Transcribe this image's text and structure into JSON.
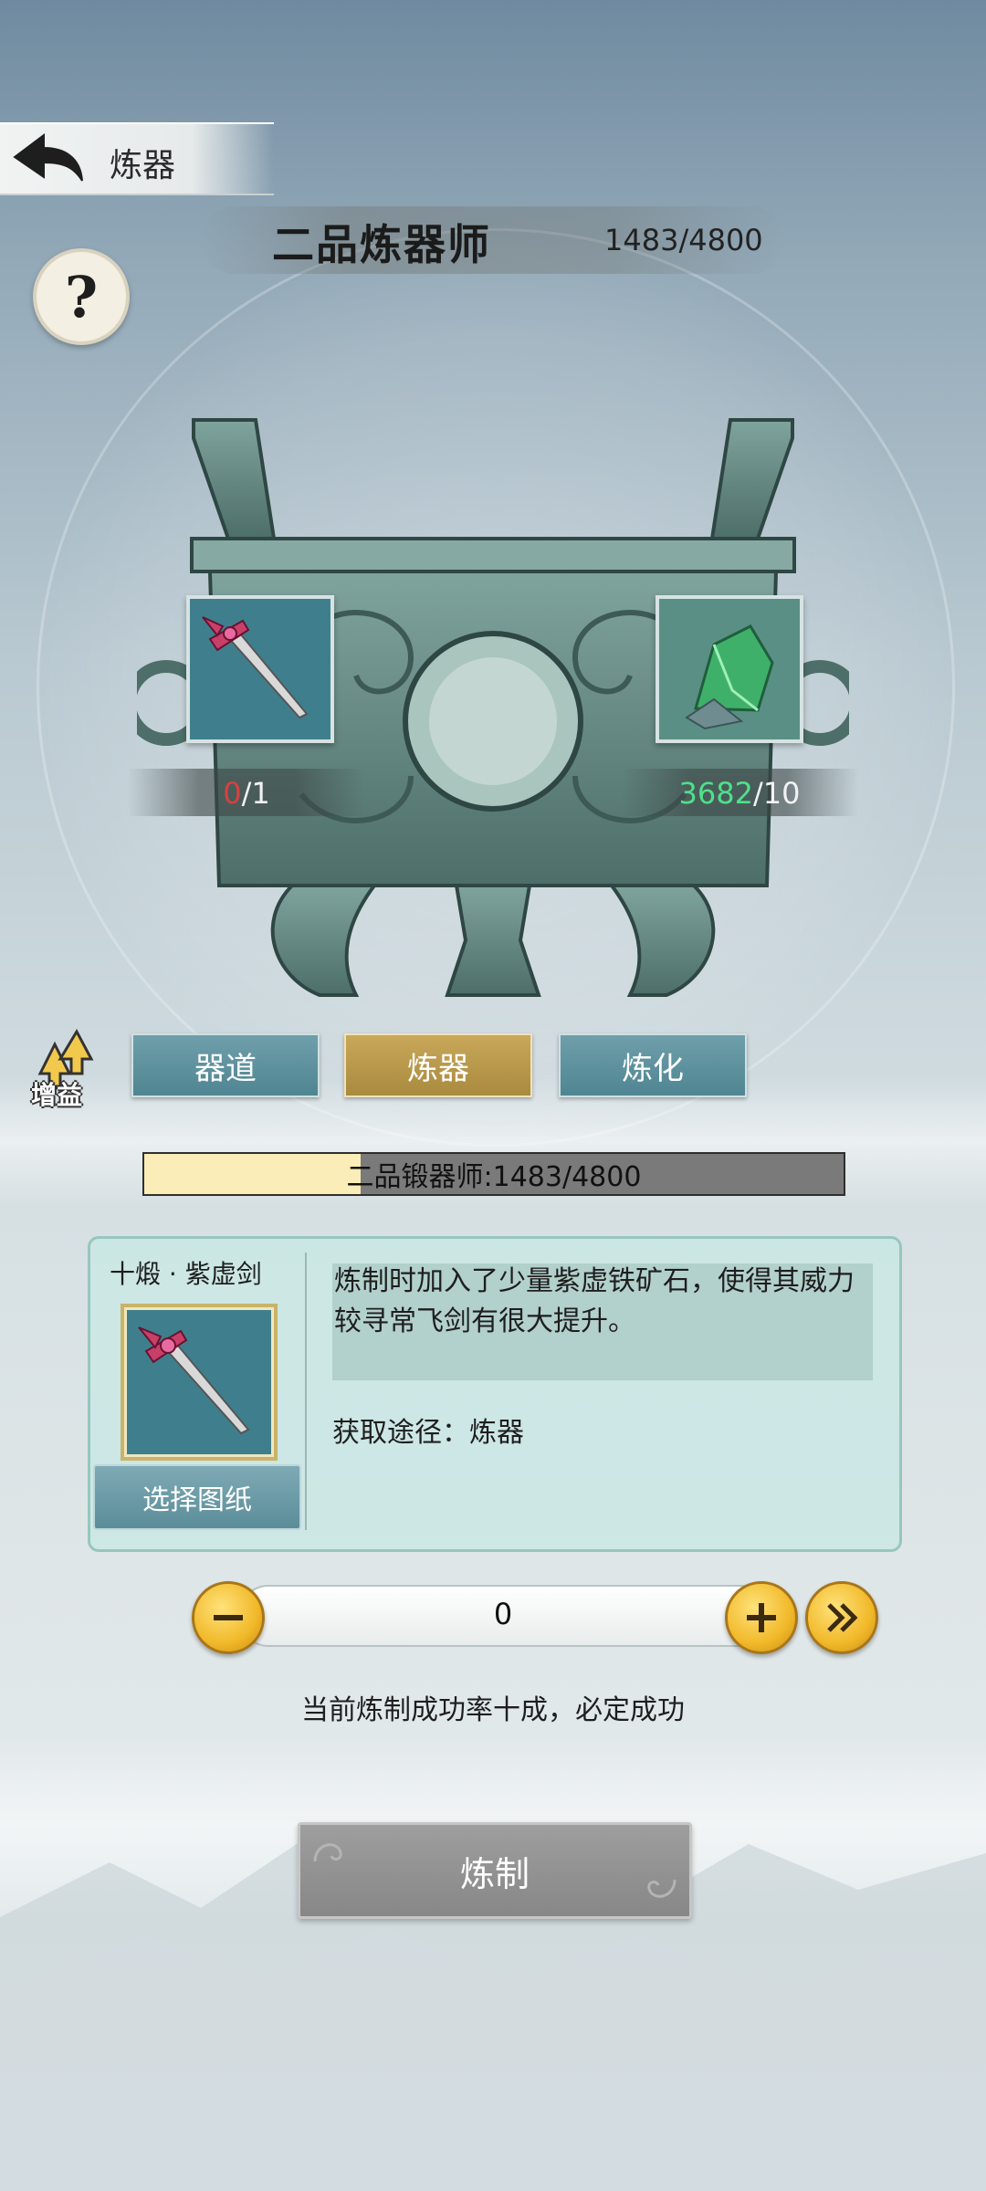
{
  "header": {
    "title": "炼器"
  },
  "rank": {
    "title": "二品炼器师",
    "progress_text": "1483/4800"
  },
  "help": {
    "symbol": "?"
  },
  "slots": {
    "left": {
      "icon": "sword-blueprint-icon",
      "current": "0",
      "total": "/1"
    },
    "right": {
      "icon": "green-ore-crystal-icon",
      "current": "3682",
      "total": "/10"
    }
  },
  "buff": {
    "label": "增益"
  },
  "tabs": [
    {
      "label": "器道",
      "active": false
    },
    {
      "label": "炼器",
      "active": true
    },
    {
      "label": "炼化",
      "active": false
    }
  ],
  "progress": {
    "label": "二品锻器师:1483/4800",
    "fraction": 0.309
  },
  "item": {
    "name": "十煅 · 紫虚剑",
    "select_label": "选择图纸",
    "description": "炼制时加入了少量紫虚铁矿石，使得其威力较寻常飞剑有很大提升。",
    "source": "获取途径：炼器"
  },
  "quantity": {
    "value": "0"
  },
  "rate_text": "当前炼制成功率十成，必定成功",
  "craft_label": "炼制",
  "colors": {
    "accent_gold": "#c9a85a",
    "tab_teal": "#5b8d99",
    "count_red": "#d84040",
    "count_green": "#4fe08a",
    "progress_fill": "#fbedb7"
  }
}
